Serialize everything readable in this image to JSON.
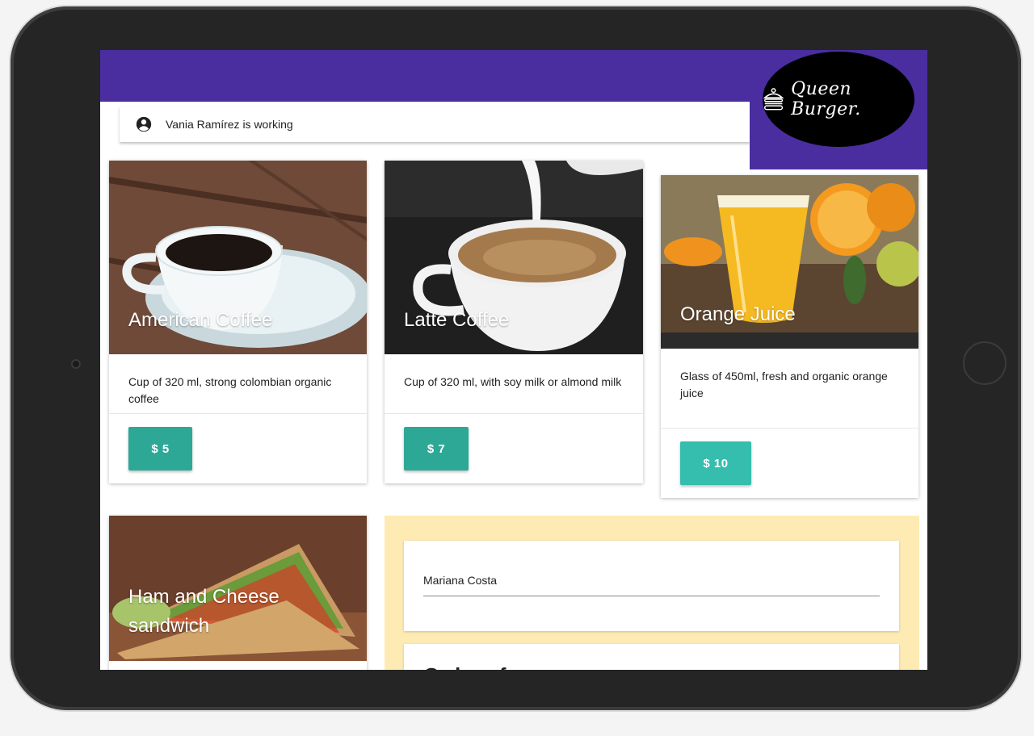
{
  "header": {
    "brand_name": "Queen Burger.",
    "brand_icon": "burger-icon",
    "colors": {
      "header_bg": "#4a2ea0",
      "logo_bg": "#000000"
    }
  },
  "worker": {
    "icon": "account-circle-icon",
    "status_text": "Vania Ramírez is working"
  },
  "products": [
    {
      "name": "American Coffee",
      "description": "Cup of 320 ml, strong colombian organic coffee",
      "price": "$ 5",
      "image": "american-coffee-image"
    },
    {
      "name": "Latte Coffee",
      "description": "Cup of 320 ml, with soy milk or almond milk",
      "price": "$ 7",
      "image": "latte-coffee-image"
    },
    {
      "name": "Orange Juice",
      "description": "Glass of 450ml, fresh and organic orange juice",
      "price": "$ 10",
      "image": "orange-juice-image"
    },
    {
      "name": "Ham and Cheese sandwich",
      "image": "sandwich-image"
    }
  ],
  "button_colors": {
    "primary": "#2ea896",
    "hover": "#35bdae"
  },
  "order": {
    "customer_name": "Mariana Costa",
    "section_title": "Order of..."
  }
}
